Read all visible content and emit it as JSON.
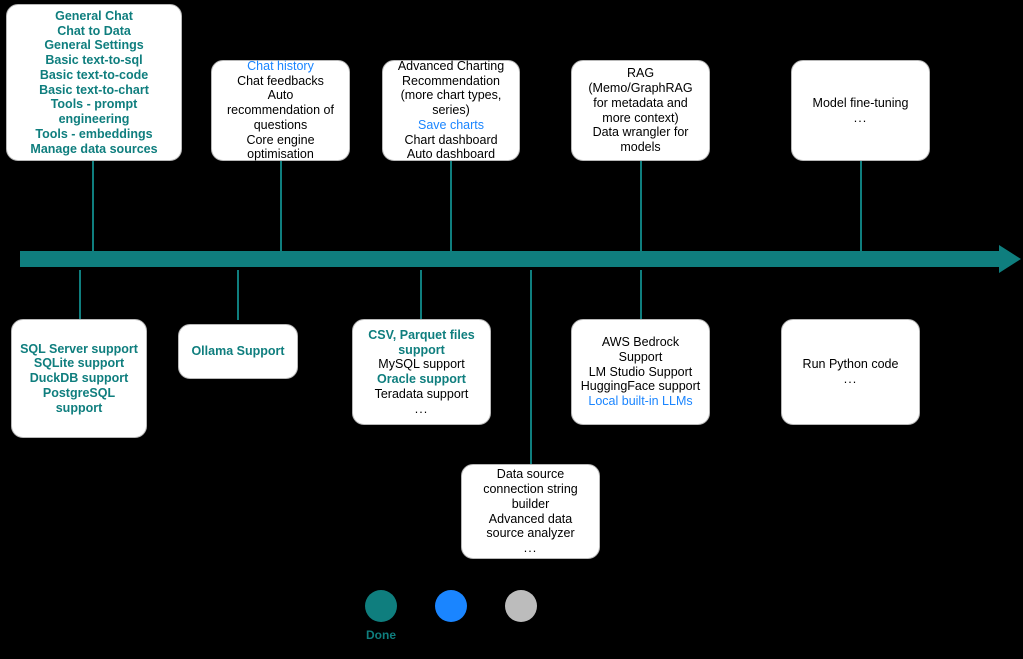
{
  "diagram": {
    "title": "Product Roadmap Timeline",
    "colors": {
      "done": "#0f7e7e",
      "in_progress": "#1a85ff",
      "planned": "#bcbcbc",
      "timeline": "#0f7e7e",
      "card_background": "#ffffff",
      "canvas_background": "#000000"
    }
  },
  "timeline": {
    "axis_label": "timeline-arrow",
    "direction": "left-to-right"
  },
  "above_cards": [
    {
      "id": "card-foundation",
      "status": "done",
      "lines": [
        {
          "text": "General Chat",
          "status": "done"
        },
        {
          "text": "Chat to Data",
          "status": "done"
        },
        {
          "text": "General Settings",
          "status": "done"
        },
        {
          "text": "Basic text-to-sql",
          "status": "done"
        },
        {
          "text": "Basic text-to-code",
          "status": "done"
        },
        {
          "text": "Basic text-to-chart",
          "status": "done"
        },
        {
          "text": "Tools - prompt engineering",
          "status": "done"
        },
        {
          "text": "Tools - embeddings",
          "status": "done"
        },
        {
          "text": "Manage data sources",
          "status": "done"
        }
      ]
    },
    {
      "id": "card-chat-experience",
      "status": "mixed",
      "lines": [
        {
          "text": "Chat history",
          "status": "in_progress"
        },
        {
          "text": "Chat feedbacks",
          "status": "planned"
        },
        {
          "text": "Auto recommendation of questions",
          "status": "planned"
        },
        {
          "text": "Core engine optimisation",
          "status": "planned"
        }
      ]
    },
    {
      "id": "card-charting",
      "status": "mixed",
      "lines": [
        {
          "text": "Advanced Charting Recommendation (more chart types, series)",
          "status": "planned"
        },
        {
          "text": "Save charts",
          "status": "in_progress"
        },
        {
          "text": "Chart dashboard",
          "status": "planned"
        },
        {
          "text": "Auto dashboard",
          "status": "planned"
        }
      ]
    },
    {
      "id": "card-rag",
      "status": "planned",
      "lines": [
        {
          "text": "RAG (Memo/GraphRAG for metadata and more context)",
          "status": "planned"
        },
        {
          "text": "Data wrangler for models",
          "status": "planned"
        }
      ]
    },
    {
      "id": "card-fine-tuning",
      "status": "planned",
      "lines": [
        {
          "text": "Model fine-tuning",
          "status": "planned"
        },
        {
          "text": "...",
          "status": "planned"
        }
      ]
    }
  ],
  "below_cards": [
    {
      "id": "card-databases",
      "status": "done",
      "lines": [
        {
          "text": "SQL Server support",
          "status": "done"
        },
        {
          "text": "SQLite support",
          "status": "done"
        },
        {
          "text": "DuckDB support",
          "status": "done"
        },
        {
          "text": "PostgreSQL support",
          "status": "done"
        }
      ]
    },
    {
      "id": "card-ollama",
      "status": "done",
      "lines": [
        {
          "text": "Ollama Support",
          "status": "done"
        }
      ]
    },
    {
      "id": "card-file-sources",
      "status": "mixed",
      "lines": [
        {
          "text": "CSV, Parquet files support",
          "status": "done"
        },
        {
          "text": "MySQL support",
          "status": "planned"
        },
        {
          "text": "Oracle support",
          "status": "done"
        },
        {
          "text": "Teradata support",
          "status": "planned"
        },
        {
          "text": "...",
          "status": "planned"
        }
      ]
    },
    {
      "id": "card-llm-providers",
      "status": "mixed",
      "lines": [
        {
          "text": "AWS Bedrock Support",
          "status": "planned"
        },
        {
          "text": "LM Studio Support",
          "status": "planned"
        },
        {
          "text": "HuggingFace support",
          "status": "planned"
        },
        {
          "text": "Local built-in LLMs",
          "status": "in_progress"
        }
      ]
    },
    {
      "id": "card-python",
      "status": "planned",
      "lines": [
        {
          "text": "Run Python code",
          "status": "planned"
        },
        {
          "text": "...",
          "status": "planned"
        }
      ]
    }
  ],
  "bottom_cards": [
    {
      "id": "card-data-source-tools",
      "status": "planned",
      "lines": [
        {
          "text": "Data source connection string builder",
          "status": "planned"
        },
        {
          "text": "Advanced data source analyzer",
          "status": "planned"
        },
        {
          "text": "...",
          "status": "planned"
        }
      ]
    }
  ],
  "legend": {
    "items": [
      {
        "id": "legend-done",
        "label": "Done",
        "color": "#0f7e7e"
      },
      {
        "id": "legend-in-progress",
        "label": "",
        "color": "#1a85ff"
      },
      {
        "id": "legend-planned",
        "label": "",
        "color": "#bcbcbc"
      }
    ]
  }
}
